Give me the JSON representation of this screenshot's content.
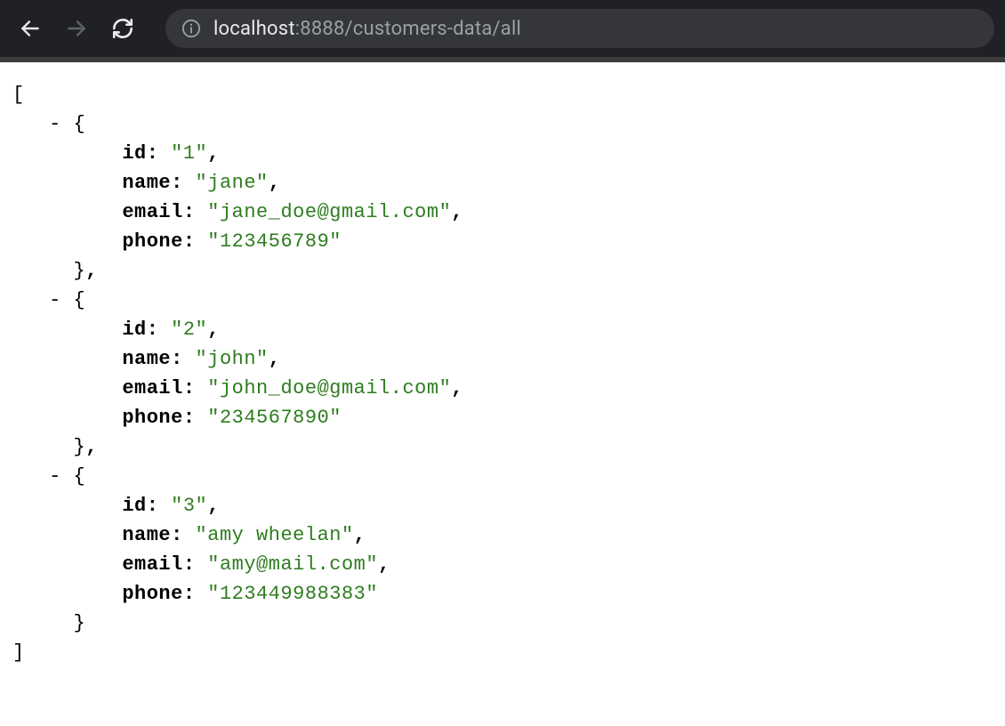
{
  "browser": {
    "url_host": "localhost",
    "url_rest": ":8888/customers-data/all"
  },
  "json": {
    "open_bracket": "[",
    "close_bracket": "]",
    "dash": "-",
    "open_brace": "{",
    "close_brace": "}",
    "comma": ",",
    "key_id": "id:",
    "key_name": "name:",
    "key_email": "email:",
    "key_phone": "phone:",
    "items": [
      {
        "id": "\"1\"",
        "name": "\"jane\"",
        "email": "\"jane_doe@gmail.com\"",
        "phone": "\"123456789\""
      },
      {
        "id": "\"2\"",
        "name": "\"john\"",
        "email": "\"john_doe@gmail.com\"",
        "phone": "\"234567890\""
      },
      {
        "id": "\"3\"",
        "name": "\"amy wheelan\"",
        "email": "\"amy@mail.com\"",
        "phone": "\"123449988383\""
      }
    ]
  }
}
